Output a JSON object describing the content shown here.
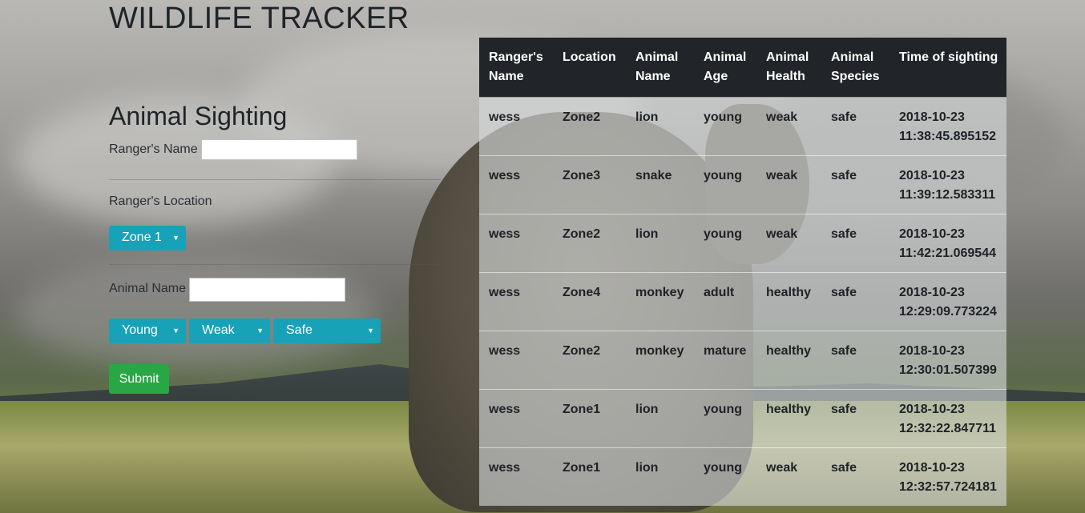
{
  "header": {
    "title": "WILDLIFE TRACKER"
  },
  "form": {
    "heading": "Animal Sighting",
    "ranger_name_label": "Ranger's Name",
    "ranger_name_value": "",
    "ranger_location_label": "Ranger's Location",
    "location_select": "Zone 1",
    "animal_name_label": "Animal Name",
    "animal_name_value": "",
    "age_select": "Young",
    "health_select": "Weak",
    "species_select": "Safe",
    "submit_label": "Submit"
  },
  "table": {
    "headers": [
      "Ranger's Name",
      "Location",
      "Animal Name",
      "Animal Age",
      "Animal Health",
      "Animal Species",
      "Time of sighting"
    ],
    "rows": [
      [
        "wess",
        "Zone2",
        "lion",
        "young",
        "weak",
        "safe",
        "2018-10-23 11:38:45.895152"
      ],
      [
        "wess",
        "Zone3",
        "snake",
        "young",
        "weak",
        "safe",
        "2018-10-23 11:39:12.583311"
      ],
      [
        "wess",
        "Zone2",
        "lion",
        "young",
        "weak",
        "safe",
        "2018-10-23 11:42:21.069544"
      ],
      [
        "wess",
        "Zone4",
        "monkey",
        "adult",
        "healthy",
        "safe",
        "2018-10-23 12:29:09.773224"
      ],
      [
        "wess",
        "Zone2",
        "monkey",
        "mature",
        "healthy",
        "safe",
        "2018-10-23 12:30:01.507399"
      ],
      [
        "wess",
        "Zone1",
        "lion",
        "young",
        "healthy",
        "safe",
        "2018-10-23 12:32:22.847711"
      ],
      [
        "wess",
        "Zone1",
        "lion",
        "young",
        "weak",
        "safe",
        "2018-10-23 12:32:57.724181"
      ]
    ]
  },
  "colors": {
    "select": "#17a2b8",
    "submit": "#28a745",
    "table_header": "#212529"
  },
  "icons": {
    "select_caret": "caret-down-icon"
  }
}
